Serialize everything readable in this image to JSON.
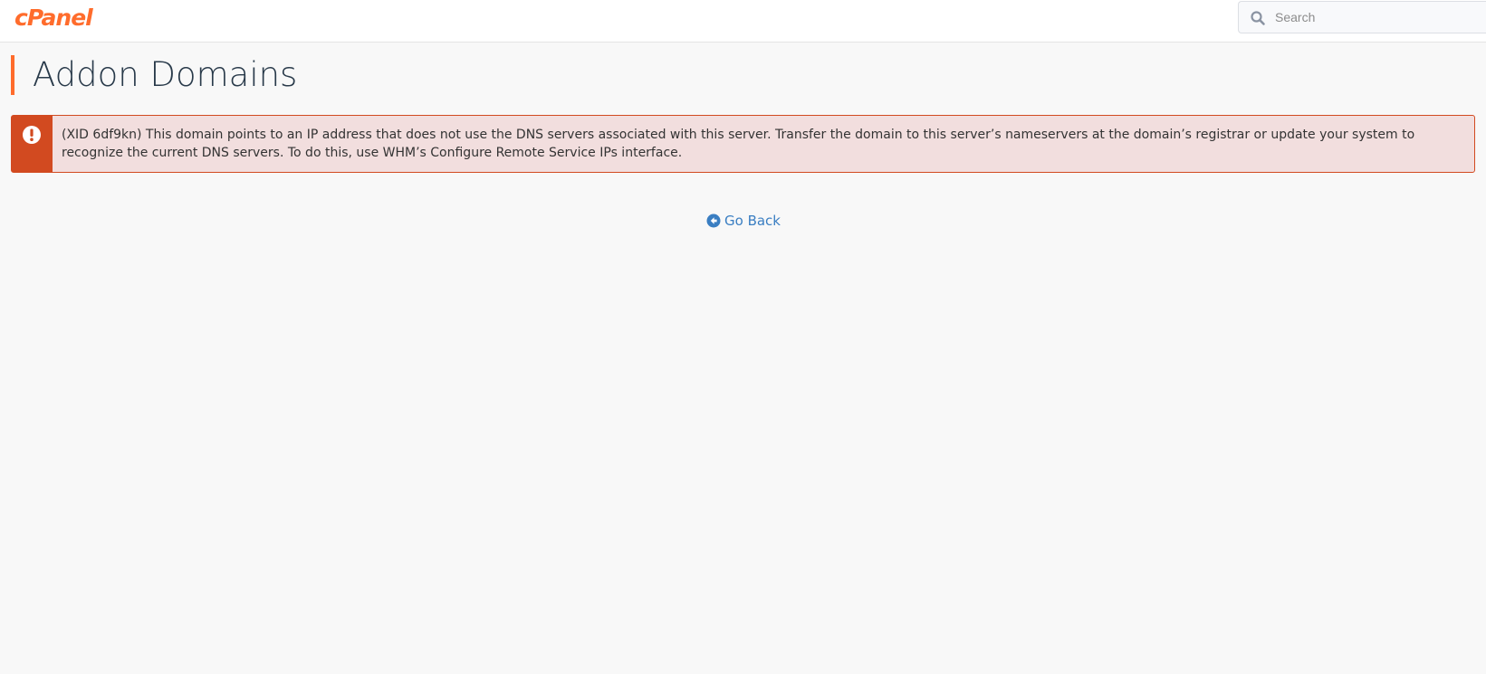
{
  "header": {
    "logo_text": "cPanel",
    "logo_color": "#ff6c2c",
    "search": {
      "placeholder": "Search",
      "value": "",
      "icon": "search-icon"
    }
  },
  "page": {
    "title": "Addon Domains",
    "accent_color": "#ff6c2c"
  },
  "alert": {
    "type": "error",
    "icon": "exclamation-circle-icon",
    "color": "#d24a20",
    "background": "#f2dede",
    "message": "(XID 6df9kn) This domain points to an IP address that does not use the DNS servers associated with this server. Transfer the domain to this server’s nameservers at the domain’s registrar or update your system to recognize the current DNS servers. To do this, use WHM’s Configure Remote Service IPs interface."
  },
  "actions": {
    "go_back_label": "Go Back",
    "go_back_icon": "arrow-circle-left-icon",
    "link_color": "#3a7ec2"
  }
}
